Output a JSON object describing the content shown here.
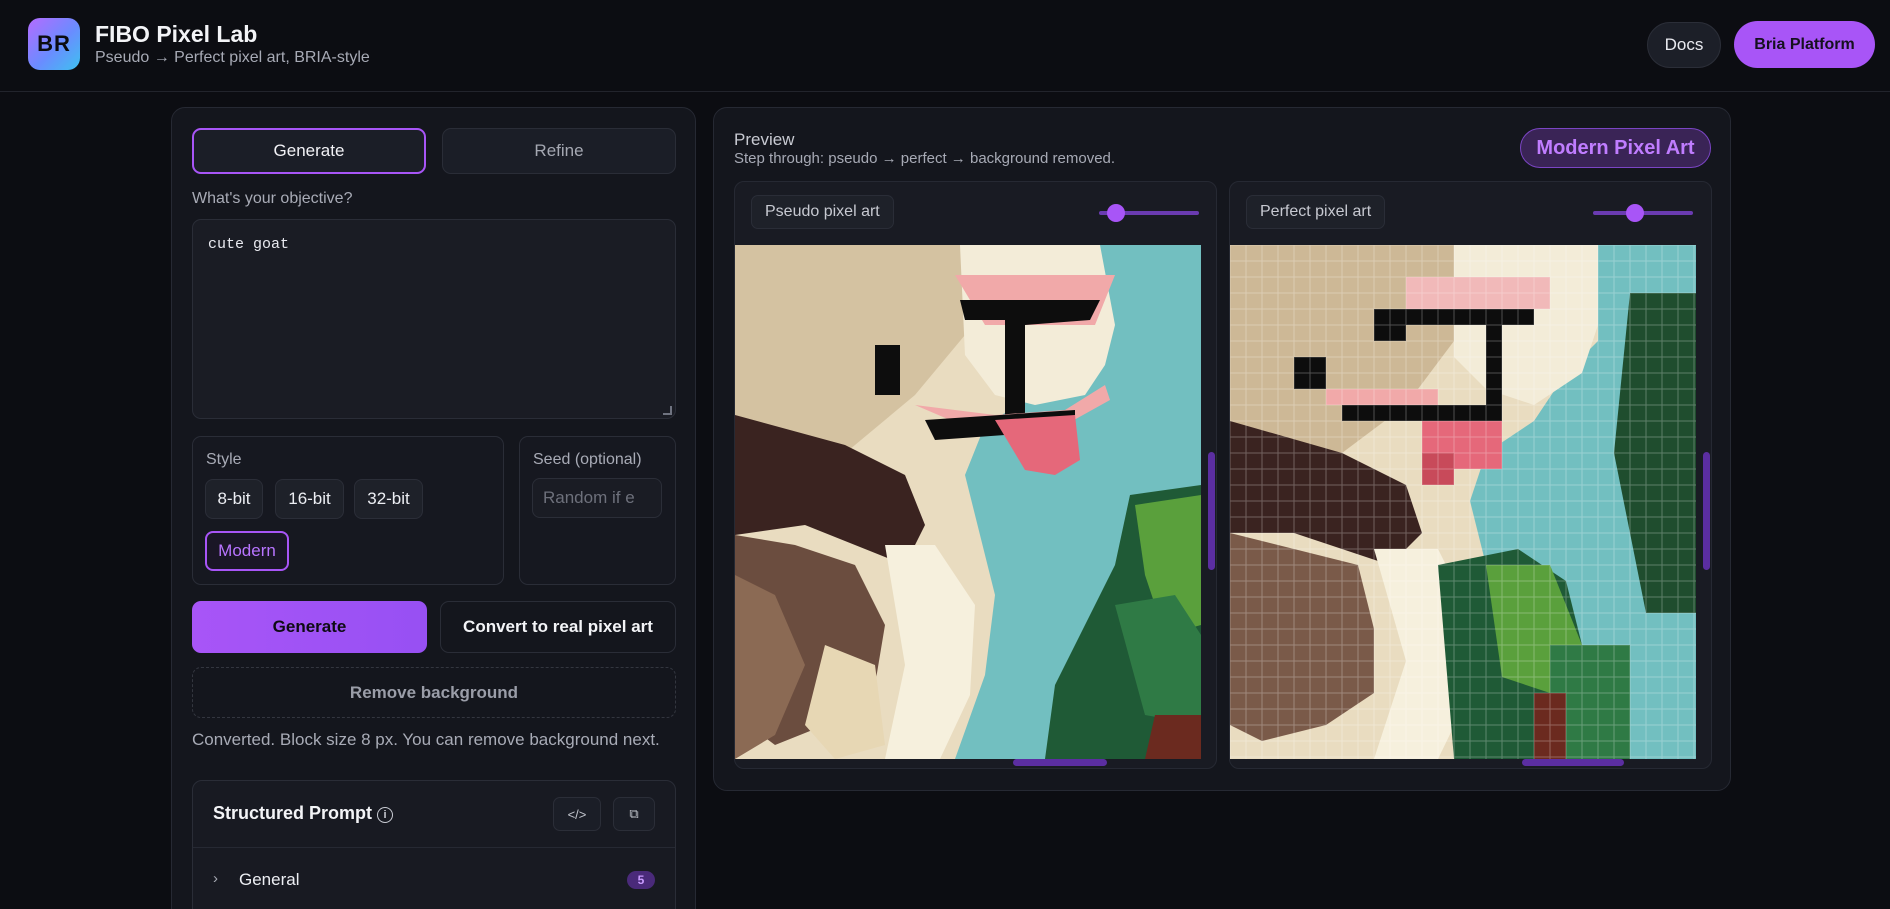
{
  "header": {
    "logo_text": "BR",
    "title": "FIBO Pixel Lab",
    "subtitle": "Pseudo → Perfect pixel art, BRIA-style",
    "docs_label": "Docs",
    "platform_label": "Bria Platform"
  },
  "left": {
    "tabs": {
      "generate": "Generate",
      "refine": "Refine"
    },
    "objective_label": "What's your objective?",
    "prompt_value": "cute goat",
    "style": {
      "label": "Style",
      "options": [
        "8-bit",
        "16-bit",
        "32-bit",
        "Modern"
      ],
      "selected": "Modern"
    },
    "seed": {
      "label": "Seed (optional)",
      "placeholder": "Random if e"
    },
    "generate_label": "Generate",
    "convert_label": "Convert to real pixel art",
    "remove_bg_label": "Remove background",
    "status": "Converted. Block size 8 px. You can remove background next.",
    "structured": {
      "title": "Structured Prompt",
      "info_icon": "i",
      "code_icon": "</>",
      "copy_icon": "⧉",
      "sections": [
        {
          "label": "General",
          "count": "5"
        }
      ]
    }
  },
  "preview": {
    "title": "Preview",
    "subtitle": "Step through: pseudo → perfect → background removed.",
    "mode_badge": "Modern Pixel Art",
    "panes": [
      {
        "label": "Pseudo pixel art",
        "slider_position": 0.17
      },
      {
        "label": "Perfect pixel art",
        "slider_position": 0.42
      }
    ]
  },
  "colors": {
    "accent": "#a855f7",
    "background": "#0c0d12",
    "panel": "#14161d",
    "sky": "#72bfc0",
    "fur_light": "#f3ecd8",
    "fur_dark": "#3a2320",
    "nose_pink": "#f1a9a9",
    "tongue": "#e5687a",
    "tree_dark": "#1f5a36",
    "tree_light": "#5aa03c"
  }
}
